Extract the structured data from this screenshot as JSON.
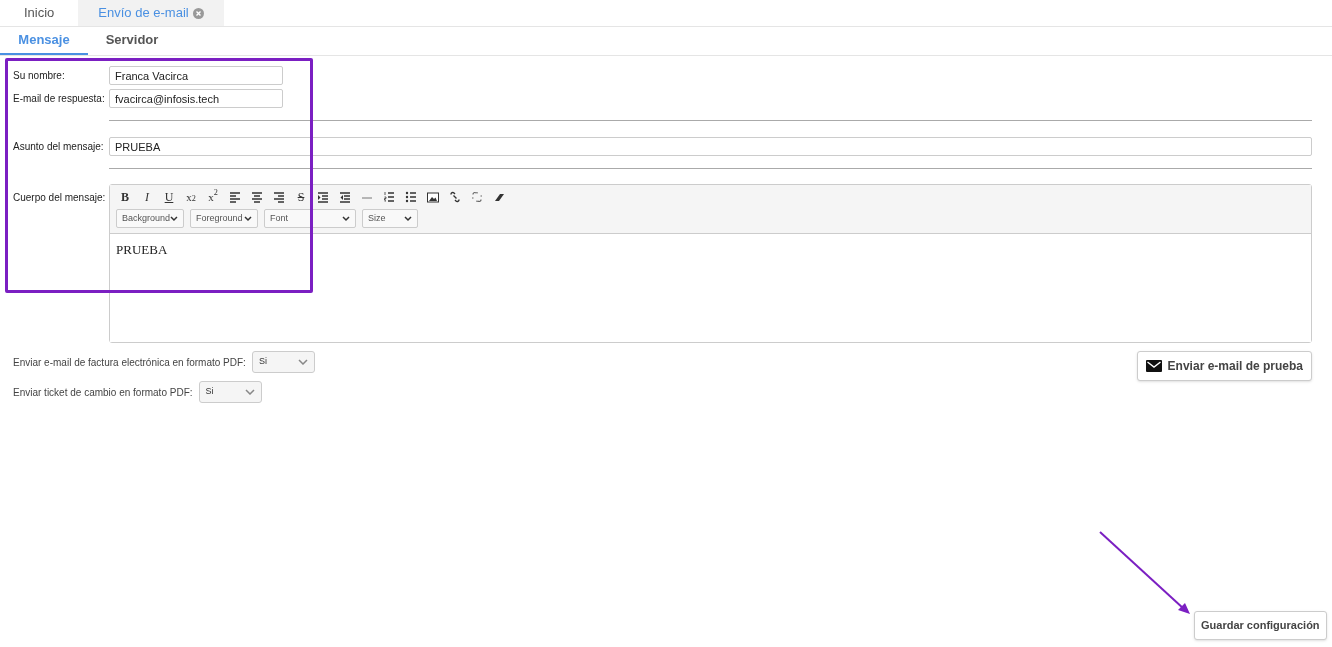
{
  "top_tabs": [
    {
      "label": "Inicio",
      "selected": false,
      "closable": false
    },
    {
      "label": "Envío de e-mail",
      "selected": true,
      "closable": true
    }
  ],
  "sub_tabs": [
    {
      "label": "Mensaje",
      "selected": true
    },
    {
      "label": "Servidor",
      "selected": false
    }
  ],
  "fields": [
    {
      "label": "Su nombre:",
      "value": "Franca Vacirca",
      "kind": "short"
    },
    {
      "label": "E-mail de respuesta:",
      "value": "fvacirca@infosis.tech",
      "kind": "short"
    },
    {
      "label": "Asunto del mensaje:",
      "value": "PRUEBA",
      "kind": "wide"
    }
  ],
  "editor": {
    "label": "Cuerpo del mensaje:",
    "toolbar": [
      {
        "kind": "bold",
        "label": "B"
      },
      {
        "kind": "italic",
        "label": "I"
      },
      {
        "kind": "underline",
        "label": "U"
      },
      {
        "kind": "subscript",
        "label": "x$_{2}$"
      },
      {
        "kind": "superscript",
        "label": "x$^{2}$"
      },
      {
        "kind": "align-left"
      },
      {
        "kind": "align-center"
      },
      {
        "kind": "align-right"
      },
      {
        "kind": "strike",
        "label": "S"
      },
      {
        "kind": "indent"
      },
      {
        "kind": "outdent"
      },
      {
        "kind": "rule"
      },
      {
        "kind": "ordered-list"
      },
      {
        "kind": "bullet-list"
      },
      {
        "kind": "image"
      },
      {
        "kind": "link"
      },
      {
        "kind": "unlink"
      },
      {
        "kind": "eraser"
      }
    ],
    "dropdowns": [
      "Background",
      "Foreground",
      "Font",
      "Size"
    ],
    "body": "PRUEBA"
  },
  "options": [
    {
      "label": "Enviar e-mail de factura electrónica en formato PDF:",
      "value": "Si"
    },
    {
      "label": "Enviar ticket de cambio en formato PDF:",
      "value": "Si"
    }
  ],
  "test_button": "Enviar e-mail de prueba",
  "save_button": "Guardar configuración"
}
